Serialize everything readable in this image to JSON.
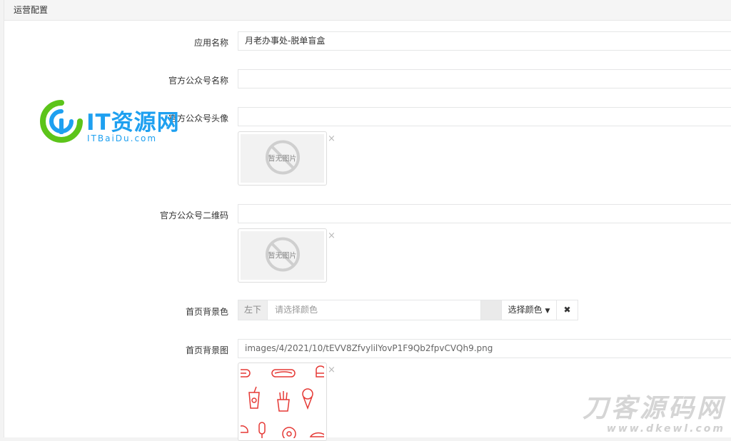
{
  "panel": {
    "title": "运营配置"
  },
  "fields": {
    "app_name": {
      "label": "应用名称",
      "value": "月老办事处-脱单盲盒"
    },
    "official_name": {
      "label": "官方公众号名称",
      "value": ""
    },
    "official_avatar": {
      "label": "官方公众号头像",
      "value": "",
      "placeholder_text": "暂无图片"
    },
    "official_qrcode": {
      "label": "官方公众号二维码",
      "value": "",
      "placeholder_text": "暂无图片"
    },
    "home_bg_color": {
      "label": "首页背景色",
      "addon": "左下",
      "placeholder": "请选择颜色",
      "pick_label": "选择颜色",
      "clear_label": "✖"
    },
    "home_bg_image": {
      "label": "首页背景图",
      "value": "images/4/2021/10/tEVV8ZfvylilYovP1F9Qb2fpvCVQh9.png"
    }
  },
  "close_glyph": "×",
  "watermarks": {
    "left_brand": "IT资源网",
    "left_sub": "ITBaiDu.com",
    "right_brand": "刀客源码网",
    "right_sub": "www.dkewl.com"
  },
  "colors": {
    "accent_blue": "#1ea0f0",
    "accent_green": "#5cc41a",
    "pattern_red": "#e53935"
  }
}
